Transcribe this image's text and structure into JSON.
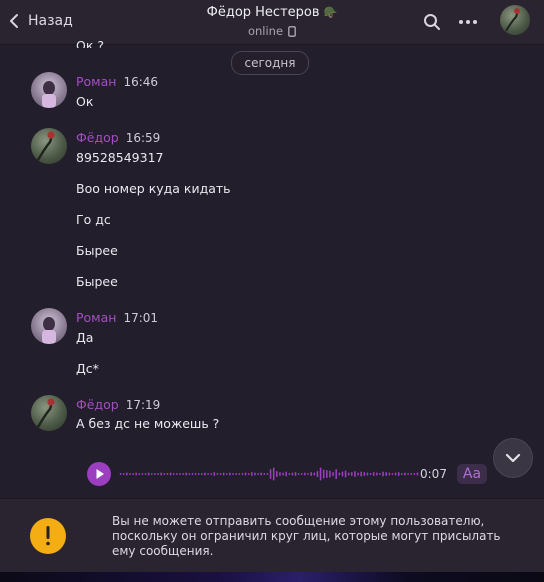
{
  "header": {
    "back_label": "Назад",
    "title": "Фёдор Нестеров",
    "title_emoji": "🪖",
    "status": "online"
  },
  "chat": {
    "cut_message": "Ок ?",
    "date_separator": "сегодня",
    "groups": [
      {
        "sender": "Роман",
        "time": "16:46",
        "messages": [
          "Ок"
        ]
      },
      {
        "sender": "Фёдор",
        "time": "16:59",
        "messages": [
          "89528549317",
          "Воо номер куда кидать",
          "Го дс",
          "Бырее",
          "Бырее"
        ]
      },
      {
        "sender": "Роман",
        "time": "17:01",
        "messages": [
          "Да",
          "Дс*"
        ]
      },
      {
        "sender": "Фёдор",
        "time": "17:19",
        "messages": [
          "А без дс не можешь ?"
        ]
      }
    ],
    "voice": {
      "duration": "0:07",
      "transcribe_label": "Аа"
    }
  },
  "notice": {
    "text": "Вы не можете отправить сообщение этому пользователю, поскольку он ограничил круг лиц, которые могут присылать ему сообщения."
  },
  "colors": {
    "accent": "#9b3fc0",
    "sender_name": "#a34fc2",
    "warning": "#f5ad14",
    "background": "#231e2b"
  },
  "icons": {
    "back": "chevron-left-icon",
    "search": "search-icon",
    "more": "more-horizontal-icon",
    "phone": "phone-icon",
    "play": "play-icon",
    "scroll_down": "chevron-down-icon",
    "warning": "exclamation-icon"
  }
}
